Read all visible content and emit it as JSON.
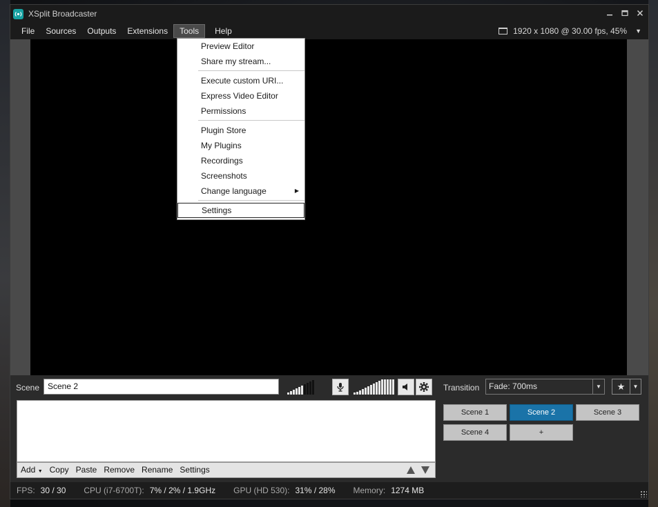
{
  "window": {
    "title": "XSplit Broadcaster",
    "controls": [
      "minimize",
      "maximize",
      "close"
    ]
  },
  "menu": {
    "items": [
      "File",
      "Sources",
      "Outputs",
      "Extensions",
      "Tools",
      "Help"
    ],
    "active": "Tools",
    "resolution": "1920 x 1080 @ 30.00 fps, 45%"
  },
  "tools_menu": {
    "group1": [
      "Preview Editor",
      "Share my stream..."
    ],
    "group2": [
      "Execute custom URI...",
      "Express Video Editor",
      "Permissions"
    ],
    "group3": [
      "Plugin Store",
      "My Plugins",
      "Recordings",
      "Screenshots",
      "Change language"
    ],
    "group4": [
      "Settings"
    ],
    "focused": "Settings"
  },
  "scene_panel": {
    "label": "Scene",
    "name_value": "Scene 2",
    "sources_toolbar": [
      "Add",
      "Copy",
      "Paste",
      "Remove",
      "Rename",
      "Settings"
    ]
  },
  "transition": {
    "label": "Transition",
    "value": "Fade: 700ms"
  },
  "scenes": {
    "buttons": [
      "Scene 1",
      "Scene 2",
      "Scene 3",
      "Scene 4",
      "+"
    ],
    "active": "Scene 2"
  },
  "status": {
    "fps_label": "FPS:",
    "fps_value": "30 / 30",
    "cpu_label": "CPU (i7-6700T):",
    "cpu_value": "7% / 2% / 1.9GHz",
    "gpu_label": "GPU (HD 530):",
    "gpu_value": "31% / 28%",
    "mem_label": "Memory:",
    "mem_value": "1274 MB"
  },
  "colors": {
    "accent": "#1a73a8",
    "app_icon": "#17a2a2"
  }
}
